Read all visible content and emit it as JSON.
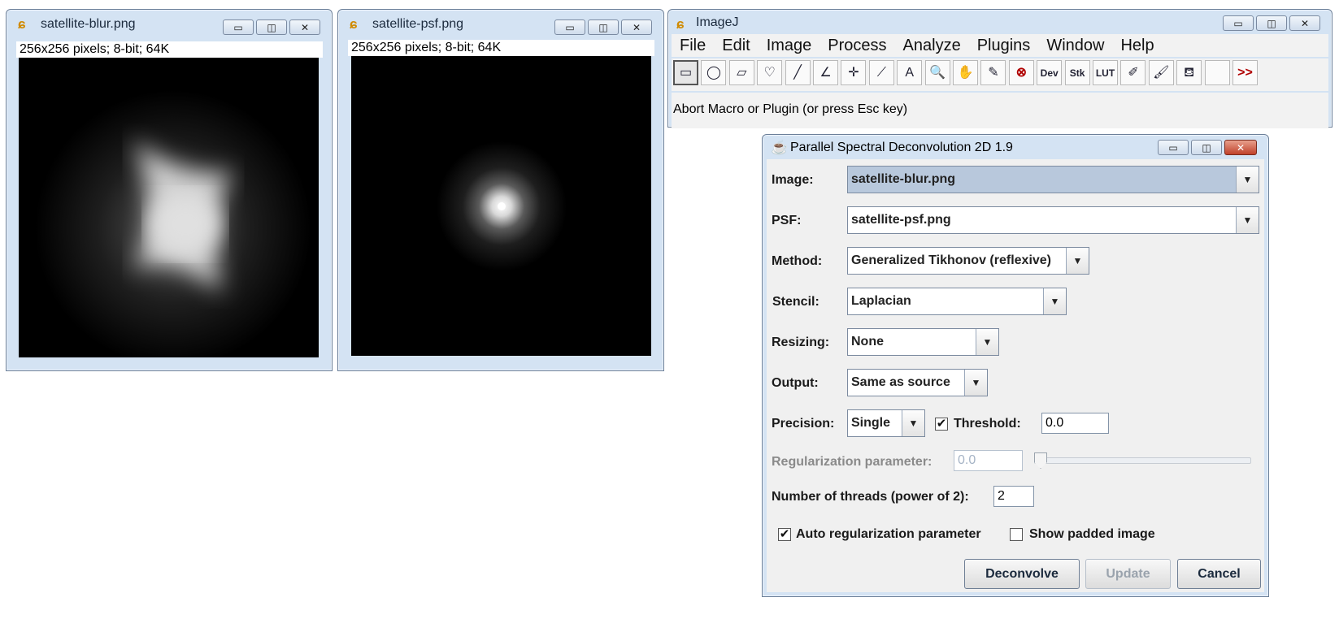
{
  "blur_window": {
    "title": "satellite-blur.png",
    "info": "256x256 pixels; 8-bit; 64K"
  },
  "psf_window": {
    "title": "satellite-psf.png",
    "info": "256x256 pixels; 8-bit; 64K"
  },
  "imagej": {
    "title": "ImageJ",
    "menu": [
      "File",
      "Edit",
      "Image",
      "Process",
      "Analyze",
      "Plugins",
      "Window",
      "Help"
    ],
    "tools": [
      {
        "name": "rectangle-tool",
        "glyph": "▭"
      },
      {
        "name": "oval-tool",
        "glyph": "◯"
      },
      {
        "name": "polygon-tool",
        "glyph": "▱"
      },
      {
        "name": "freehand-tool",
        "glyph": "♡"
      },
      {
        "name": "line-tool",
        "glyph": "╱"
      },
      {
        "name": "angle-tool",
        "glyph": "∠"
      },
      {
        "name": "point-tool",
        "glyph": "✛"
      },
      {
        "name": "wand-tool",
        "glyph": "⟋"
      },
      {
        "name": "text-tool",
        "glyph": "A"
      },
      {
        "name": "zoom-tool",
        "glyph": "🔍"
      },
      {
        "name": "scroll-tool",
        "glyph": "✋"
      },
      {
        "name": "color-picker-tool",
        "glyph": "✎"
      },
      {
        "name": "abort-tool",
        "glyph": "⊗"
      },
      {
        "name": "dev-menu-tool",
        "glyph": "Dev"
      },
      {
        "name": "stk-menu-tool",
        "glyph": "Stk"
      },
      {
        "name": "lut-menu-tool",
        "glyph": "LUT"
      },
      {
        "name": "pencil-tool",
        "glyph": "✐"
      },
      {
        "name": "brush-tool",
        "glyph": "🖌"
      },
      {
        "name": "flood-fill-tool",
        "glyph": "⛾"
      },
      {
        "name": "empty-tool",
        "glyph": ""
      },
      {
        "name": "more-tools",
        "glyph": ">>"
      }
    ],
    "status": "Abort Macro or Plugin (or press Esc key)"
  },
  "dialog": {
    "title": "Parallel Spectral Deconvolution 2D 1.9",
    "image_label": "Image:",
    "image_value": "satellite-blur.png",
    "psf_label": "PSF:",
    "psf_value": "satellite-psf.png",
    "method_label": "Method:",
    "method_value": "Generalized Tikhonov (reflexive)",
    "stencil_label": "Stencil:",
    "stencil_value": "Laplacian",
    "resizing_label": "Resizing:",
    "resizing_value": "None",
    "output_label": "Output:",
    "output_value": "Same as source",
    "precision_label": "Precision:",
    "precision_value": "Single",
    "threshold_label": "Threshold:",
    "threshold_checked": true,
    "threshold_value": "0.0",
    "reg_param_label": "Regularization parameter:",
    "reg_param_value": "0.0",
    "reg_slider_fraction": 0.0,
    "threads_label": "Number of threads (power of 2):",
    "threads_value": "2",
    "auto_reg_label": "Auto regularization parameter",
    "auto_reg_checked": true,
    "show_padded_label": "Show padded image",
    "show_padded_checked": false,
    "deconvolve_label": "Deconvolve",
    "update_label": "Update",
    "cancel_label": "Cancel"
  }
}
